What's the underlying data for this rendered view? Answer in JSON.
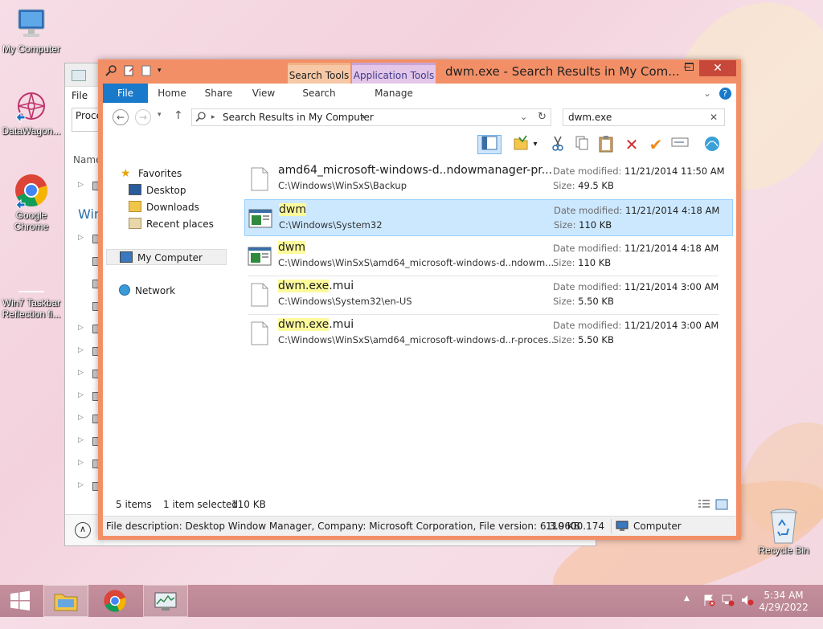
{
  "desktop": {
    "icons": [
      {
        "label": "My Computer"
      },
      {
        "label": "DataWagon..."
      },
      {
        "label": "Google Chrome"
      },
      {
        "label": "Win7 Taskbar Reflection fi..."
      },
      {
        "label": "Recycle Bin"
      }
    ]
  },
  "bg_window": {
    "menu_file": "File",
    "tab_partial": "Proce",
    "header_partial": "Name",
    "group_partial": "Win"
  },
  "explorer": {
    "title": "dwm.exe - Search Results in My Com...",
    "context_tabs": {
      "search_tools": "Search Tools",
      "application_tools": "Application Tools"
    },
    "ribbon_tabs": [
      "File",
      "Home",
      "Share",
      "View",
      "Search",
      "Manage"
    ],
    "address_path": "Search Results in My Computer",
    "search_value": "dwm.exe",
    "nav": {
      "favorites": "Favorites",
      "desktop": "Desktop",
      "downloads": "Downloads",
      "recent": "Recent places",
      "my_computer": "My Computer",
      "network": "Network"
    },
    "labels": {
      "date_modified": "Date modified:",
      "size": "Size:"
    },
    "items": [
      {
        "name_plain": "amd64_microsoft-windows-d..ndowmanager-pr...",
        "name_highlight": "",
        "name_suffix": "",
        "path": "C:\\Windows\\WinSxS\\Backup",
        "date": "11/21/2014 11:50 AM",
        "size": "49.5 KB",
        "icon": "file-icon",
        "selected": false
      },
      {
        "name_plain": "",
        "name_highlight": "dwm",
        "name_suffix": "",
        "path": "C:\\Windows\\System32",
        "date": "11/21/2014 4:18 AM",
        "size": "110 KB",
        "icon": "exe-icon",
        "selected": true
      },
      {
        "name_plain": "",
        "name_highlight": "dwm",
        "name_suffix": "",
        "path": "C:\\Windows\\WinSxS\\amd64_microsoft-windows-d..ndowm...",
        "date": "11/21/2014 4:18 AM",
        "size": "110 KB",
        "icon": "exe-icon",
        "selected": false
      },
      {
        "name_plain": "",
        "name_highlight": "dwm.exe",
        "name_suffix": ".mui",
        "path": "C:\\Windows\\System32\\en-US",
        "date": "11/21/2014 3:00 AM",
        "size": "5.50 KB",
        "icon": "file-icon",
        "selected": false
      },
      {
        "name_plain": "",
        "name_highlight": "dwm.exe",
        "name_suffix": ".mui",
        "path": "C:\\Windows\\WinSxS\\amd64_microsoft-windows-d..r-proces...",
        "date": "11/21/2014 3:00 AM",
        "size": "5.50 KB",
        "icon": "file-icon",
        "selected": false
      }
    ],
    "status": {
      "count": "5 items",
      "selected": "1 item selected",
      "selected_size": "110 KB"
    },
    "details": {
      "description": "File description: Desktop Window Manager, Company: Microsoft Corporation, File version: 6.3.9600.174",
      "size": "110 KB",
      "location": "Computer"
    }
  },
  "taskbar": {
    "time": "5:34 AM",
    "date": "4/29/2022"
  },
  "colors": {
    "window_frame": "#f38f66",
    "ribbon_file": "#1979ca",
    "selection": "#cce8ff",
    "highlight": "#fdfa9b",
    "taskbar": "#c08c9a"
  }
}
